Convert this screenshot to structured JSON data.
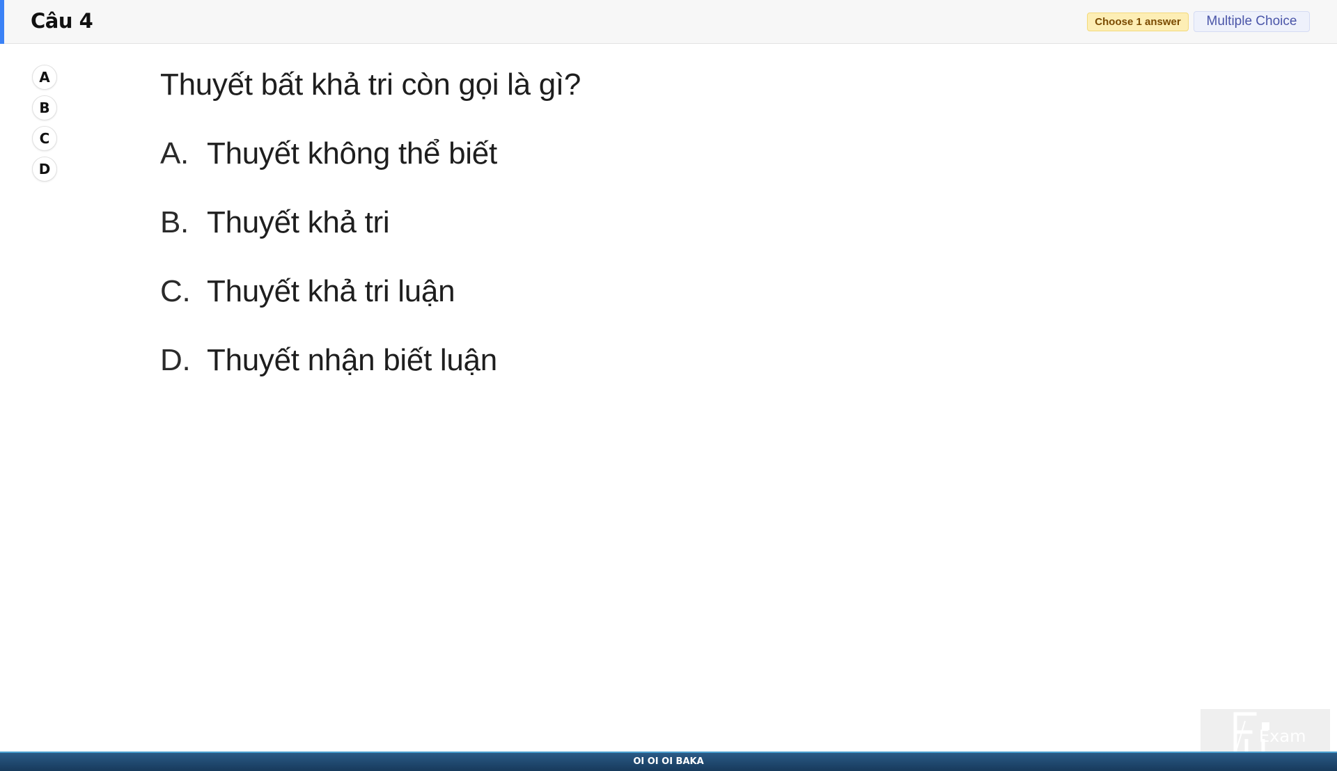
{
  "header": {
    "question_number": "Câu 4",
    "instruction_badge": "Choose 1 answer",
    "type_badge": "Multiple Choice",
    "accent_color": "#3b82f6"
  },
  "option_bubbles": [
    "A",
    "B",
    "C",
    "D"
  ],
  "question": {
    "text": "Thuyết bất khả tri còn gọi là gì?",
    "answers": [
      {
        "letter": "A.",
        "text": "Thuyết không thể biết"
      },
      {
        "letter": "B.",
        "text": "Thuyết khả tri"
      },
      {
        "letter": "C.",
        "text": "Thuyết khả tri luận"
      },
      {
        "letter": "D.",
        "text": "Thuyết nhận biết luận"
      }
    ]
  },
  "footer": {
    "text": "OI OI OI BAKA"
  },
  "logo": {
    "icon": "fu-exam-logo",
    "text": "Exam"
  }
}
